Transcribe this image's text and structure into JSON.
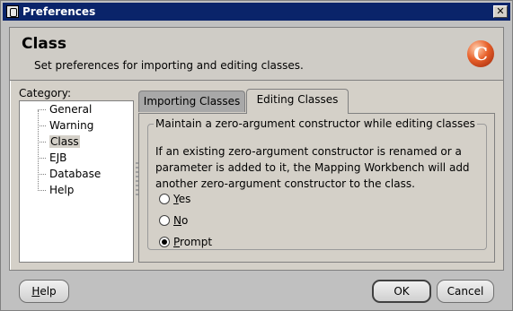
{
  "window": {
    "title": "Preferences",
    "close_label": "✕"
  },
  "header": {
    "title": "Class",
    "description": "Set preferences for importing and editing classes.",
    "logo_letter": "C"
  },
  "category": {
    "label": "Category:",
    "items": [
      "General",
      "Warning",
      "Class",
      "EJB",
      "Database",
      "Help"
    ],
    "selected": "Class"
  },
  "tabs": [
    {
      "label": "Importing Classes",
      "active": false
    },
    {
      "label": "Editing Classes",
      "active": true
    }
  ],
  "editing": {
    "group_title": "Maintain a zero-argument constructor while editing classes",
    "description": "If an existing zero-argument constructor is renamed or a parameter is added to it, the Mapping Workbench will add another zero-argument constructor to the class.",
    "options": [
      {
        "first": "Y",
        "rest": "es",
        "checked": false
      },
      {
        "first": "N",
        "rest": "o",
        "checked": false
      },
      {
        "first": "P",
        "rest": "rompt",
        "checked": true
      }
    ]
  },
  "buttons": {
    "help": "Help",
    "help_first": "H",
    "help_rest": "elp",
    "ok": "OK",
    "cancel": "Cancel"
  }
}
